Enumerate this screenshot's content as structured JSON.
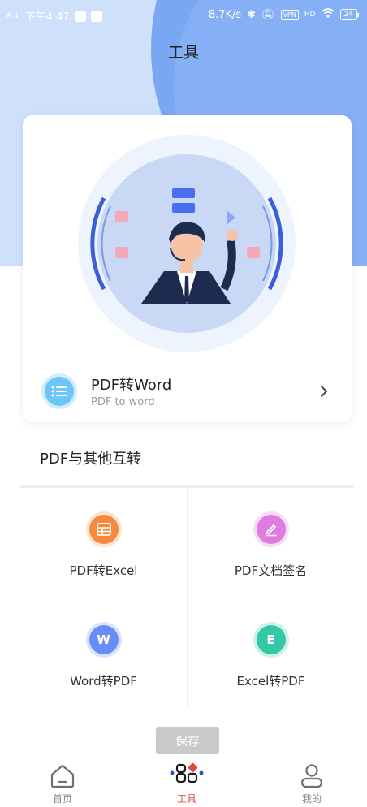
{
  "status_bar": {
    "time": "下午4:47",
    "network_speed": "8.7K/s",
    "vpn_badge": "VPN",
    "signal_label": "HD",
    "battery": "24"
  },
  "header": {
    "title": "工具"
  },
  "hero": {
    "title": "PDF转Word",
    "subtitle": "PDF to word"
  },
  "section": {
    "title": "PDF与其他互转"
  },
  "tools": [
    {
      "label": "PDF转Excel",
      "icon": "table-icon",
      "color": "#f58a3e",
      "ring": "#fde3cf"
    },
    {
      "label": "PDF文档签名",
      "icon": "pen-icon",
      "color": "#e07ce0",
      "ring": "#f8dcf7"
    },
    {
      "label": "Word转PDF",
      "icon": "word-icon",
      "glyph": "W",
      "color": "#6b8cf6",
      "ring": "#d9e2fd"
    },
    {
      "label": "Excel转PDF",
      "icon": "excel-icon",
      "glyph": "E",
      "color": "#35c8a8",
      "ring": "#cdf1e8"
    }
  ],
  "save_button": "保存",
  "tabbar": {
    "active": "tools",
    "items": [
      {
        "label": "首页",
        "icon": "home-icon"
      },
      {
        "label": "工具",
        "icon": "tools-icon"
      },
      {
        "label": "我的",
        "icon": "profile-icon"
      }
    ]
  },
  "colors": {
    "header_blue": "#7aa7f2",
    "header_light": "#cfe0fb",
    "active_tab": "#e0463a",
    "hero_icon": "#6cc6f8"
  }
}
